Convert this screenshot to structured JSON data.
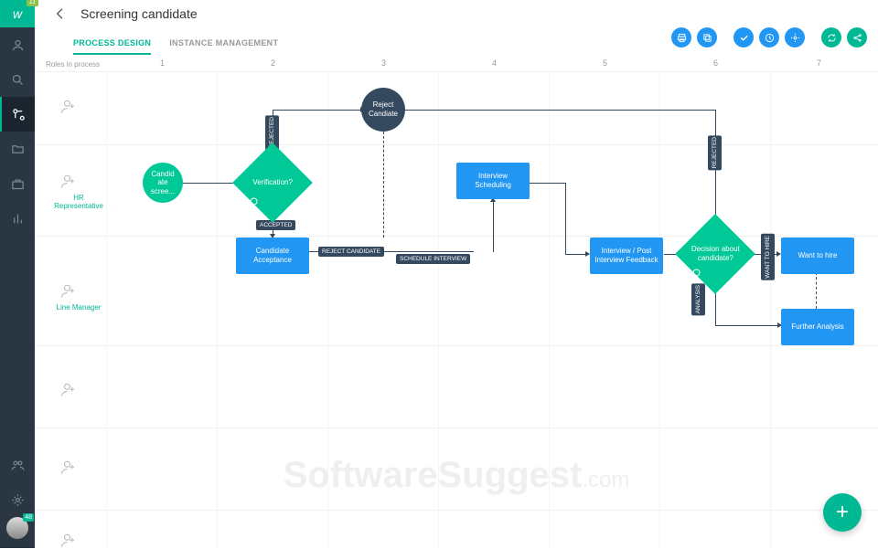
{
  "logo_badge": "11",
  "avatar_badge": "48",
  "page_title": "Screening candidate",
  "tabs": {
    "design": "PROCESS DESIGN",
    "instance": "INSTANCE MANAGEMENT"
  },
  "roles_label": "Roles in process",
  "columns": [
    "1",
    "2",
    "3",
    "4",
    "5",
    "6",
    "7"
  ],
  "roles": {
    "hr": "HR Representative",
    "lm": "Line Manager"
  },
  "nodes": {
    "start": "Candid\nate scree...",
    "verify": "Verification?",
    "reject": "Reject Candiate",
    "accept": "Candidate Acceptance",
    "schedule": "Interview Scheduling",
    "feedback": "Interview / Post Interview Feedback",
    "decision": "Decision about candidate?",
    "hire": "Want to hire",
    "analysis": "Further Analysis"
  },
  "edges": {
    "rejected": "REJECTED",
    "accepted": "ACCEPTED",
    "reject_cand": "REJECT CANDIDATE",
    "sched_int": "SCHEDULE INTERVIEW",
    "want_hire": "WANT TO HIRE",
    "analysis_e": "ANALYSIS",
    "rejected2": "REJECTED"
  },
  "watermark": {
    "main": "SoftwareSuggest",
    "suffix": ".com"
  }
}
